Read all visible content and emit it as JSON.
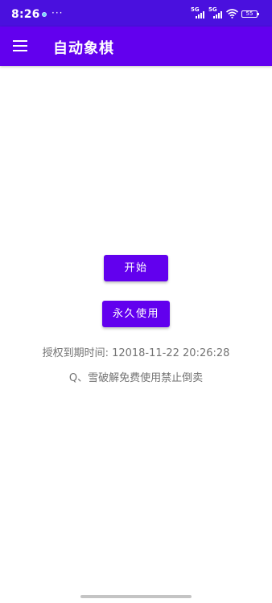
{
  "status_bar": {
    "time": "8:26",
    "more": "···",
    "signal1_label": "5G",
    "signal2_label": "5G",
    "battery": "55"
  },
  "app_bar": {
    "title": "自动象棋"
  },
  "main": {
    "start_button": "开始",
    "permanent_button": "永久使用",
    "expiry_text": "授权到期时间: 12018-11-22 20:26:28",
    "notice_text": "Q、雪破解免费使用禁止倒卖"
  },
  "colors": {
    "status_bar": "#4a10de",
    "app_bar": "#6200ee",
    "button": "#6200ee",
    "secondary_text": "#737373"
  }
}
